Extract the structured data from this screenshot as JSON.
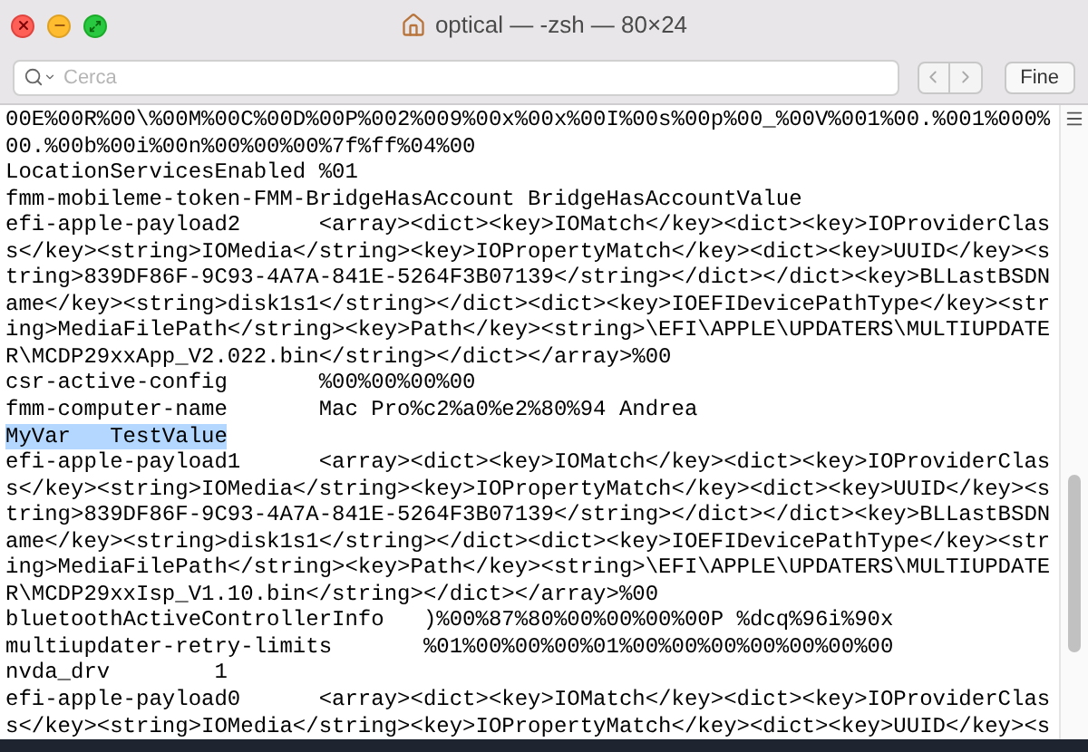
{
  "window": {
    "title": "optical — -zsh — 80×24"
  },
  "find_bar": {
    "placeholder": "Cerca",
    "done_button": "Fine"
  },
  "terminal": {
    "lines": [
      {
        "text": "00E%00R%00\\%00M%00C%00D%00P%002%009%00x%00x%00I%00s%00p%00_%00V%001%00.%001%000%",
        "selected": false
      },
      {
        "text": "00.%00b%00i%00n%00%00%00%7f%ff%04%00",
        "selected": false
      },
      {
        "text": "LocationServicesEnabled %01",
        "selected": false
      },
      {
        "text": "fmm-mobileme-token-FMM-BridgeHasAccount BridgeHasAccountValue",
        "selected": false
      },
      {
        "text": "efi-apple-payload2      <array><dict><key>IOMatch</key><dict><key>IOProviderClas",
        "selected": false
      },
      {
        "text": "s</key><string>IOMedia</string><key>IOPropertyMatch</key><dict><key>UUID</key><s",
        "selected": false
      },
      {
        "text": "tring>839DF86F-9C93-4A7A-841E-5264F3B07139</string></dict></dict><key>BLLastBSDN",
        "selected": false
      },
      {
        "text": "ame</key><string>disk1s1</string></dict><dict><key>IOEFIDevicePathType</key><str",
        "selected": false
      },
      {
        "text": "ing>MediaFilePath</string><key>Path</key><string>\\EFI\\APPLE\\UPDATERS\\MULTIUPDATE",
        "selected": false
      },
      {
        "text": "R\\MCDP29xxApp_V2.022.bin</string></dict></array>%00",
        "selected": false
      },
      {
        "text": "csr-active-config       %00%00%00%00",
        "selected": false
      },
      {
        "text": "fmm-computer-name       Mac Pro%c2%a0%e2%80%94 Andrea",
        "selected": false
      },
      {
        "text": "MyVar   TestValue",
        "selected": true
      },
      {
        "text": "efi-apple-payload1      <array><dict><key>IOMatch</key><dict><key>IOProviderClas",
        "selected": false
      },
      {
        "text": "s</key><string>IOMedia</string><key>IOPropertyMatch</key><dict><key>UUID</key><s",
        "selected": false
      },
      {
        "text": "tring>839DF86F-9C93-4A7A-841E-5264F3B07139</string></dict></dict><key>BLLastBSDN",
        "selected": false
      },
      {
        "text": "ame</key><string>disk1s1</string></dict><dict><key>IOEFIDevicePathType</key><str",
        "selected": false
      },
      {
        "text": "ing>MediaFilePath</string><key>Path</key><string>\\EFI\\APPLE\\UPDATERS\\MULTIUPDATE",
        "selected": false
      },
      {
        "text": "R\\MCDP29xxIsp_V1.10.bin</string></dict></array>%00",
        "selected": false
      },
      {
        "text": "bluetoothActiveControllerInfo   )%00%87%80%00%00%00%00P %dcq%96i%90x",
        "selected": false
      },
      {
        "text": "multiupdater-retry-limits       %01%00%00%00%01%00%00%00%00%00%00%00",
        "selected": false
      },
      {
        "text": "nvda_drv        1",
        "selected": false
      },
      {
        "text": "efi-apple-payload0      <array><dict><key>IOMatch</key><dict><key>IOProviderClas",
        "selected": false
      },
      {
        "text": "s</key><string>IOMedia</string><key>IOPropertyMatch</key><dict><key>UUID</key><s",
        "selected": false
      }
    ]
  }
}
